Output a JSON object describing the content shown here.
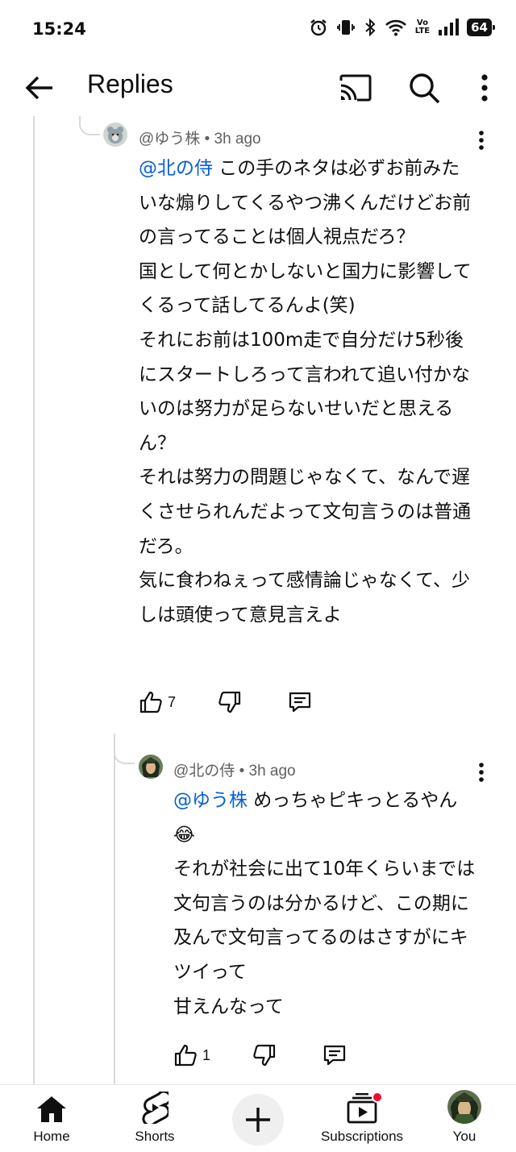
{
  "status_bar": {
    "time": "15:24",
    "battery": "64",
    "network": "VoLTE"
  },
  "header": {
    "title": "Replies"
  },
  "comments": [
    {
      "author": "@ゆう株",
      "age": "3h ago",
      "mention": "@北の侍",
      "text": " この手のネタは必ずお前みたいな煽りしてくるやつ沸くんだけどお前の言ってることは個人視点だろ？\n国として何とかしないと国力に影響してくるって話してるんよ(笑)\nそれにお前は100m走で自分だけ5秒後にスタートしろって言われて追い付かないのは努力が足らないせいだと思えるん？\nそれは努力の問題じゃなくて、なんで遅くさせられんだよって文句言うのは普通だろ。\n気に食わねぇって感情論じゃなくて、少しは頭使って意見言えよ",
      "likes": "7"
    },
    {
      "author": "@北の侍",
      "age": "3h ago",
      "mention": "@ゆう株",
      "text": " めっちゃピキっとるやん😂\nそれが社会に出て10年くらいまでは文句言うのは分かるけど、この期に及んで文句言ってるのはさすがにキツイって\n甘えんなって",
      "likes": "1"
    }
  ],
  "bottom_nav": {
    "home": "Home",
    "shorts": "Shorts",
    "subscriptions": "Subscriptions",
    "you": "You"
  },
  "colors": {
    "mention": "#065fd4",
    "meta": "#606060",
    "notification_dot": "#ff0033"
  }
}
